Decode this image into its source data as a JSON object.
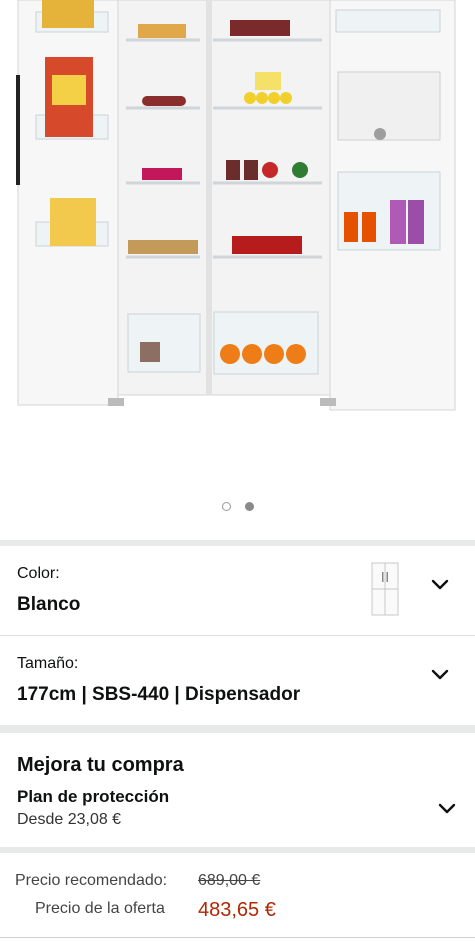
{
  "carousel": {
    "total": 2,
    "active": 2
  },
  "variants": {
    "color": {
      "label": "Color:",
      "value": "Blanco",
      "thumbnail": "fridge-thumbnail"
    },
    "size": {
      "label": "Tamaño:",
      "value": "177cm | SBS-440 | Dispensador"
    }
  },
  "upgrade": {
    "title": "Mejora tu compra",
    "plan_title": "Plan de protección",
    "plan_price": "Desde 23,08 €"
  },
  "pricing": {
    "list_label": "Precio recomendado:",
    "list_price": "689,00 €",
    "deal_label": "Precio de la oferta",
    "deal_price": "483,65 €"
  },
  "colors": {
    "price_red": "#b12704",
    "separator": "#e8eaea"
  },
  "icons": [
    "chevron-down-icon"
  ]
}
